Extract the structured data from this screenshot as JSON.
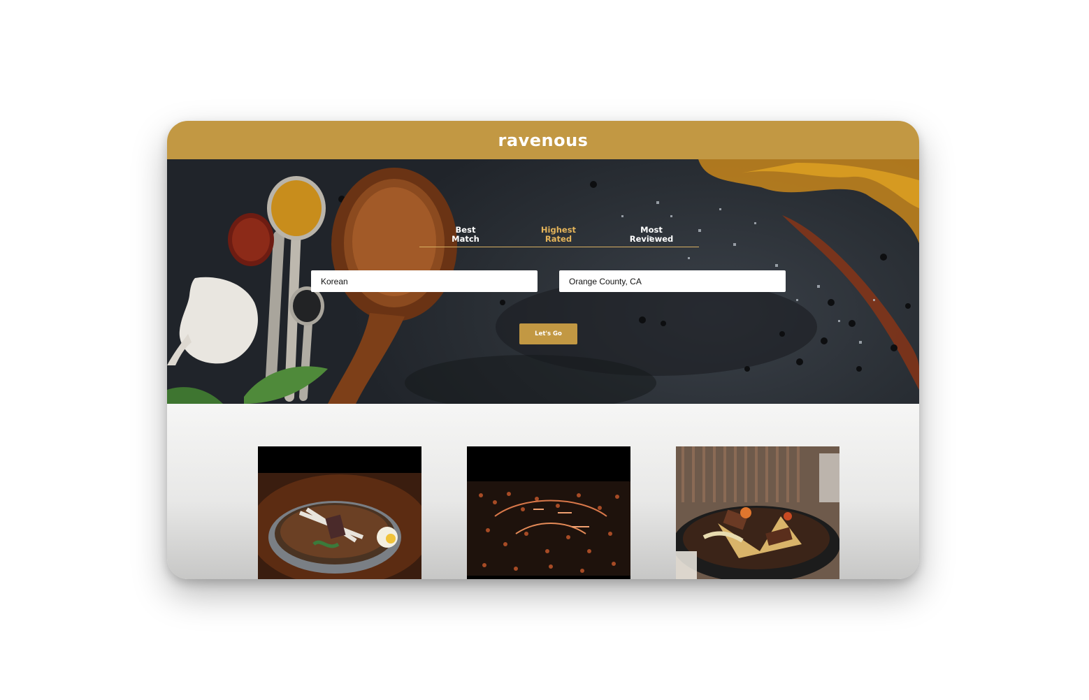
{
  "header": {
    "logo": "ravenous"
  },
  "sort_tabs": [
    {
      "line1": "Best",
      "line2": "Match",
      "active": false
    },
    {
      "line1": "Highest",
      "line2": "Rated",
      "active": true
    },
    {
      "line1": "Most",
      "line2": "Reviewed",
      "active": false
    }
  ],
  "search": {
    "term_value": "Korean",
    "location_value": "Orange County, CA",
    "submit_label": "Let's Go"
  },
  "results": [
    {
      "icon": "food-photo-cold-noodle-soup"
    },
    {
      "icon": "food-photo-neon-korean-bbq-sign"
    },
    {
      "icon": "food-photo-braised-stew"
    }
  ],
  "colors": {
    "brand": "#c29843",
    "active_tab": "#e4b45a",
    "hero_bg": "#2a2f35"
  }
}
